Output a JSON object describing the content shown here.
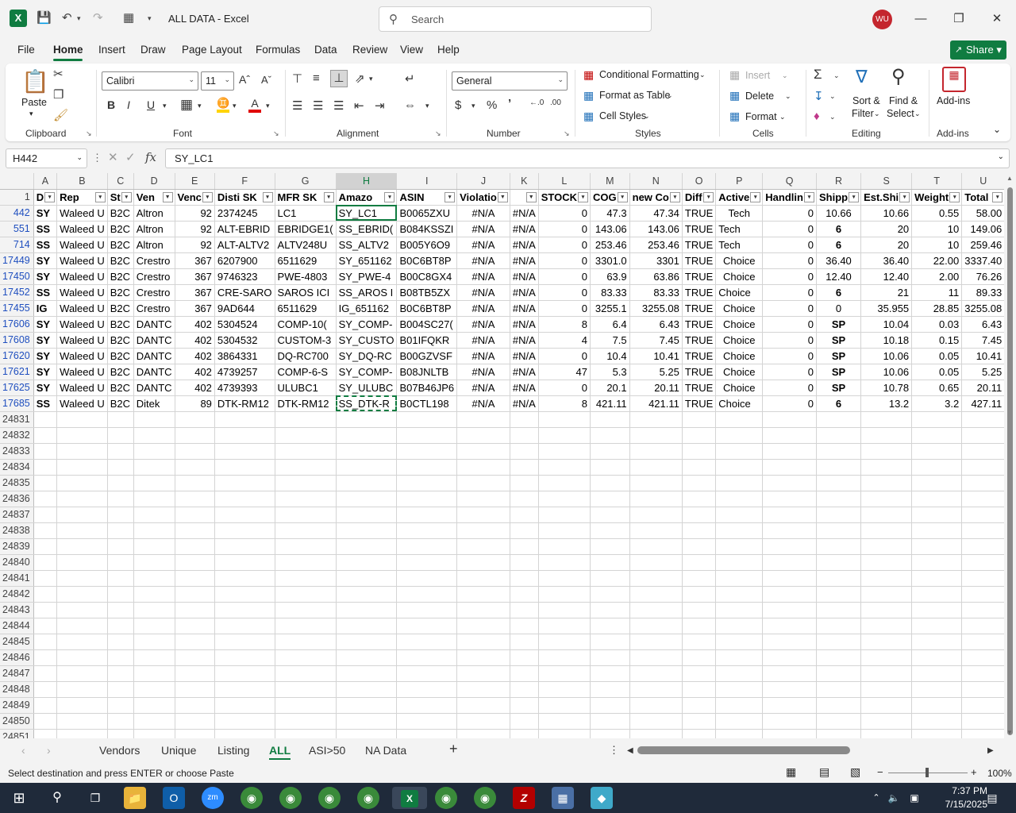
{
  "window": {
    "title": "ALL DATA  -  Excel",
    "search_placeholder": "Search",
    "user_initials": "WU"
  },
  "menu": [
    "File",
    "Home",
    "Insert",
    "Draw",
    "Page Layout",
    "Formulas",
    "Data",
    "Review",
    "View",
    "Help"
  ],
  "share_label": "Share",
  "ribbon": {
    "clipboard": {
      "label": "Clipboard",
      "paste": "Paste"
    },
    "font": {
      "label": "Font",
      "name": "Calibri",
      "size": "11"
    },
    "alignment": {
      "label": "Alignment"
    },
    "number": {
      "label": "Number",
      "format": "General"
    },
    "styles": {
      "label": "Styles",
      "cond": "Conditional Formatting",
      "table": "Format as Table",
      "cell": "Cell Styles"
    },
    "cells": {
      "label": "Cells",
      "insert": "Insert",
      "delete": "Delete",
      "format": "Format"
    },
    "editing": {
      "label": "Editing",
      "sort": "Sort &",
      "sort2": "Filter",
      "find": "Find &",
      "find2": "Select"
    },
    "addins": {
      "label": "Add-ins",
      "btn": "Add-ins"
    }
  },
  "formula": {
    "namebox": "H442",
    "content": "SY_LC1"
  },
  "columns": [
    "A",
    "B",
    "C",
    "D",
    "E",
    "F",
    "G",
    "H",
    "I",
    "J",
    "K",
    "L",
    "M",
    "N",
    "O",
    "P",
    "Q",
    "R",
    "S",
    "T",
    "U"
  ],
  "header_row": {
    "num": "1",
    "cells": [
      "D",
      "Rep",
      "St",
      "Ven",
      "Venc",
      "Disti SK",
      "MFR SK",
      "Amazo",
      "ASIN",
      "Violatio",
      "",
      "STOCK",
      "COG",
      "new Co",
      "Diff",
      "Active",
      "Handlin",
      "Shipp",
      "Est.Shi",
      "Weight",
      "Total"
    ]
  },
  "rows": [
    {
      "num": "442",
      "cells": [
        "SY",
        "Waleed U",
        "B2C",
        "Altron",
        "92",
        "2374245",
        "LC1",
        "SY_LC1",
        "B0065ZXU",
        "#N/A",
        "#N/A",
        "0",
        "47.3",
        "47.34",
        "TRUE",
        "Tech",
        "0",
        "10.66",
        "10.66",
        "0.55",
        "58.00"
      ]
    },
    {
      "num": "551",
      "cells": [
        "SS",
        "Waleed U",
        "B2C",
        "Altron",
        "92",
        "ALT-EBRID",
        "EBRIDGE1(",
        "SS_EBRID(",
        "B084KSSZI",
        "#N/A",
        "#N/A",
        "0",
        "143.06",
        "143.06",
        "TRUE",
        "Tech",
        "0",
        "6",
        "20",
        "10",
        "149.06"
      ]
    },
    {
      "num": "714",
      "cells": [
        "SS",
        "Waleed U",
        "B2C",
        "Altron",
        "92",
        "ALT-ALTV2",
        "ALTV248U",
        "SS_ALTV2",
        "B005Y6O9",
        "#N/A",
        "#N/A",
        "0",
        "253.46",
        "253.46",
        "TRUE",
        "Tech",
        "0",
        "6",
        "20",
        "10",
        "259.46"
      ]
    },
    {
      "num": "17449",
      "cells": [
        "SY",
        "Waleed U",
        "B2C",
        "Crestro",
        "367",
        "6207900",
        "6511629",
        "SY_651162",
        "B0C6BT8P",
        "#N/A",
        "#N/A",
        "0",
        "3301.0",
        "3301",
        "TRUE",
        "Choice",
        "0",
        "36.40",
        "36.40",
        "22.00",
        "3337.40"
      ]
    },
    {
      "num": "17450",
      "cells": [
        "SY",
        "Waleed U",
        "B2C",
        "Crestro",
        "367",
        "9746323",
        "PWE-4803",
        "SY_PWE-4",
        "B00C8GX4",
        "#N/A",
        "#N/A",
        "0",
        "63.9",
        "63.86",
        "TRUE",
        "Choice",
        "0",
        "12.40",
        "12.40",
        "2.00",
        "76.26"
      ]
    },
    {
      "num": "17452",
      "cells": [
        "SS",
        "Waleed U",
        "B2C",
        "Crestro",
        "367",
        "CRE-SARO",
        "SAROS ICI",
        "SS_AROS I",
        "B08TB5ZX",
        "#N/A",
        "#N/A",
        "0",
        "83.33",
        "83.33",
        "TRUE",
        "Choice",
        "0",
        "6",
        "21",
        "11",
        "89.33"
      ]
    },
    {
      "num": "17455",
      "cells": [
        "IG",
        "Waleed U",
        "B2C",
        "Crestro",
        "367",
        "9AD644",
        "6511629",
        "IG_651162",
        "B0C6BT8P",
        "#N/A",
        "#N/A",
        "0",
        "3255.1",
        "3255.08",
        "TRUE",
        "Choice",
        "0",
        "0",
        "35.955",
        "28.85",
        "3255.08"
      ]
    },
    {
      "num": "17606",
      "cells": [
        "SY",
        "Waleed U",
        "B2C",
        "DANTC",
        "402",
        "5304524",
        "COMP-10(",
        "SY_COMP-",
        "B004SC27(",
        "#N/A",
        "#N/A",
        "8",
        "6.4",
        "6.43",
        "TRUE",
        "Choice",
        "0",
        "SP",
        "10.04",
        "0.03",
        "6.43"
      ]
    },
    {
      "num": "17608",
      "cells": [
        "SY",
        "Waleed U",
        "B2C",
        "DANTC",
        "402",
        "5304532",
        "CUSTOM-3",
        "SY_CUSTO",
        "B01IFQKR",
        "#N/A",
        "#N/A",
        "4",
        "7.5",
        "7.45",
        "TRUE",
        "Choice",
        "0",
        "SP",
        "10.18",
        "0.15",
        "7.45"
      ]
    },
    {
      "num": "17620",
      "cells": [
        "SY",
        "Waleed U",
        "B2C",
        "DANTC",
        "402",
        "3864331",
        "DQ-RC700",
        "SY_DQ-RC",
        "B00GZVSF",
        "#N/A",
        "#N/A",
        "0",
        "10.4",
        "10.41",
        "TRUE",
        "Choice",
        "0",
        "SP",
        "10.06",
        "0.05",
        "10.41"
      ]
    },
    {
      "num": "17621",
      "cells": [
        "SY",
        "Waleed U",
        "B2C",
        "DANTC",
        "402",
        "4739257",
        "COMP-6-S",
        "SY_COMP-",
        "B08JNLTB",
        "#N/A",
        "#N/A",
        "47",
        "5.3",
        "5.25",
        "TRUE",
        "Choice",
        "0",
        "SP",
        "10.06",
        "0.05",
        "5.25"
      ]
    },
    {
      "num": "17625",
      "cells": [
        "SY",
        "Waleed U",
        "B2C",
        "DANTC",
        "402",
        "4739393",
        "ULUBC1",
        "SY_ULUBC",
        "B07B46JP6",
        "#N/A",
        "#N/A",
        "0",
        "20.1",
        "20.11",
        "TRUE",
        "Choice",
        "0",
        "SP",
        "10.78",
        "0.65",
        "20.11"
      ]
    },
    {
      "num": "17685",
      "cells": [
        "SS",
        "Waleed U",
        "B2C",
        "Ditek",
        "89",
        "DTK-RM12",
        "DTK-RM12",
        "SS_DTK-R",
        "B0CTL198",
        "#N/A",
        "#N/A",
        "8",
        "421.11",
        "421.11",
        "TRUE",
        "Choice",
        "0",
        "6",
        "13.2",
        "3.2",
        "427.11"
      ]
    }
  ],
  "empty_rows": [
    "24831",
    "24832",
    "24833",
    "24834",
    "24835",
    "24836",
    "24837",
    "24838",
    "24839",
    "24840",
    "24841",
    "24842",
    "24843",
    "24844",
    "24845",
    "24846",
    "24847",
    "24848",
    "24849",
    "24850",
    "24851"
  ],
  "sheets": [
    "Vendors",
    "Unique",
    "Listing",
    "ALL",
    "ASI>50",
    "NA Data"
  ],
  "active_sheet": "ALL",
  "status": {
    "message": "Select destination and press ENTER or choose Paste",
    "zoom": "100%"
  },
  "clock": {
    "time": "7:37 PM",
    "date": "7/15/2025"
  },
  "colors": {
    "accent": "#107c41",
    "sp_red": "#c00000"
  }
}
